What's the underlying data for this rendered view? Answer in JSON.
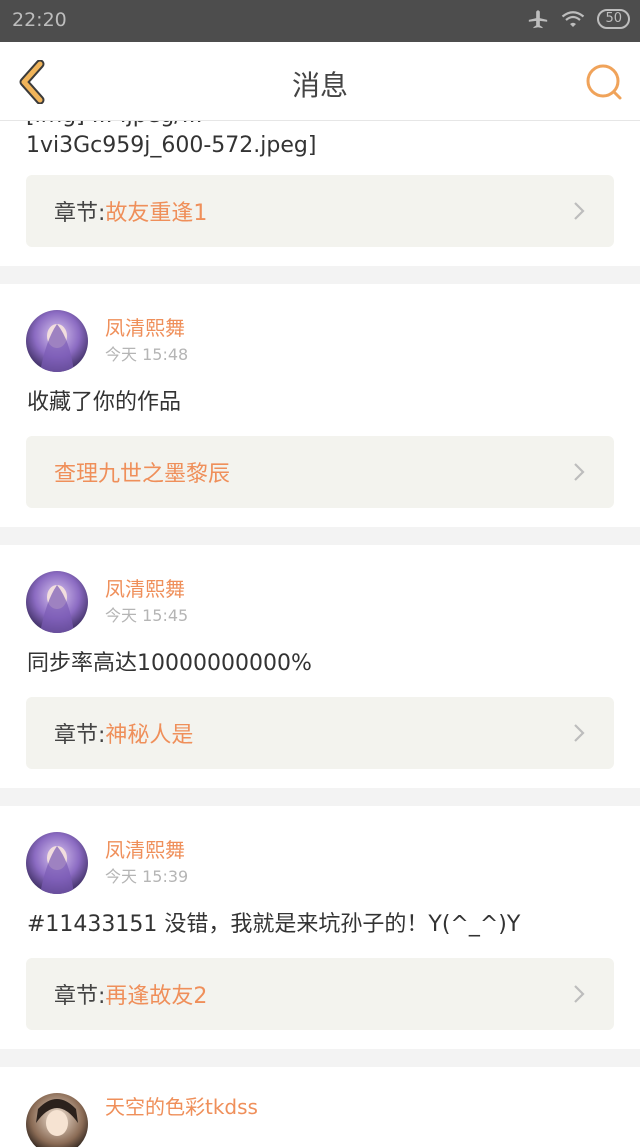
{
  "status_bar": {
    "time": "22:20",
    "battery": "50"
  },
  "nav": {
    "title": "消息"
  },
  "colors": {
    "accent": "#ef8f5a",
    "nav_icon": "#f0b45a"
  },
  "first_card": {
    "text_line_1": "[img] ... .jpeg/...",
    "text_line_2": "1vi3Gc959j_600-572.jpeg]",
    "link_prefix": "章节:",
    "link_text": "故友重逢1"
  },
  "messages": [
    {
      "user": "凤清熙舞",
      "time": "今天 15:48",
      "text": "收藏了你的作品",
      "link_prefix": "",
      "link_text": "查理九世之墨黎辰"
    },
    {
      "user": "凤清熙舞",
      "time": "今天 15:45",
      "text": "同步率高达10000000000%",
      "link_prefix": "章节:",
      "link_text": "神秘人是"
    },
    {
      "user": "凤清熙舞",
      "time": "今天 15:39",
      "text": "#11433151 没错，我就是来坑孙子的！Y(^_^)Y",
      "link_prefix": "章节:",
      "link_text": "再逢故友2"
    }
  ],
  "last_user": {
    "user": "天空的色彩tkdss"
  }
}
